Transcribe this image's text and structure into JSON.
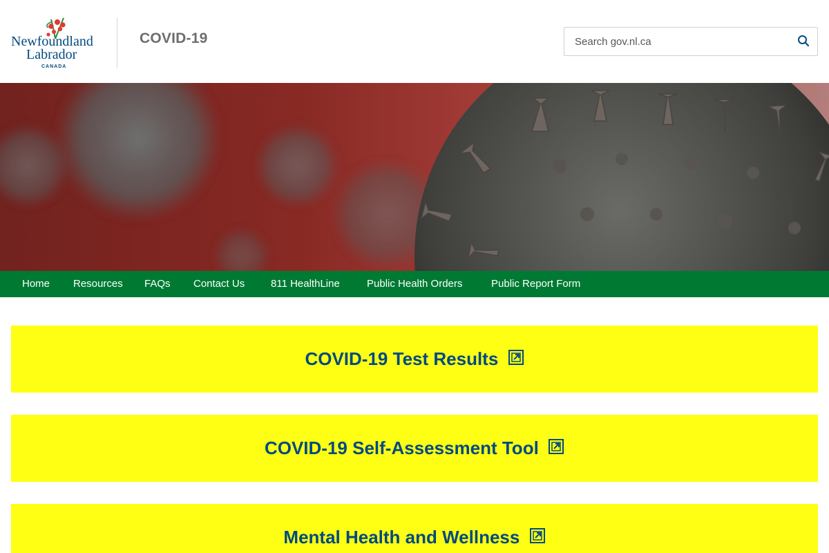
{
  "header": {
    "logo_text": {
      "line1": "Newfoundland",
      "line2": "Labrador",
      "line3": "CANADA"
    },
    "site_title": "COVID-19",
    "search": {
      "placeholder": "Search gov.nl.ca",
      "icon": "search-icon"
    }
  },
  "nav": {
    "items": [
      {
        "label": "Home"
      },
      {
        "label": "Resources"
      },
      {
        "label": "FAQs"
      },
      {
        "label": "Contact Us"
      },
      {
        "label": "811 HealthLine"
      },
      {
        "label": "Public Health Orders"
      },
      {
        "label": "Public Report Form"
      }
    ]
  },
  "cta": [
    {
      "label": "COVID-19 Test Results",
      "icon": "external-link-icon"
    },
    {
      "label": "COVID-19 Self-Assessment Tool",
      "icon": "external-link-icon"
    },
    {
      "label": "Mental Health and Wellness",
      "icon": "external-link-icon"
    }
  ],
  "colors": {
    "nav_bg": "#007a33",
    "cta_bg": "#ffff14",
    "cta_text": "#004a80",
    "title_text": "#6d6d6d",
    "logo_blue": "#004a80",
    "logo_red": "#e03a2f"
  }
}
